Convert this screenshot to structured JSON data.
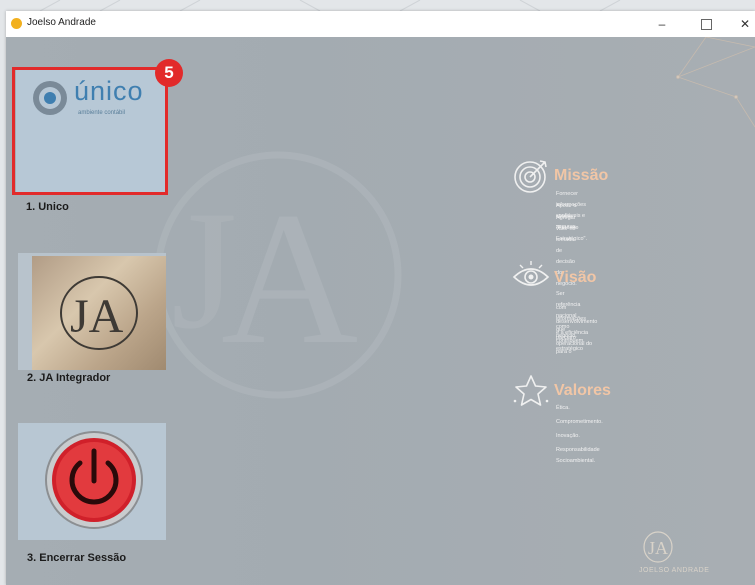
{
  "window": {
    "title": "Joelso Andrade",
    "min_label": "–",
    "close_label": "✕"
  },
  "tiles": [
    {
      "label": "1. Unico",
      "highlighted": true,
      "badge": "5"
    },
    {
      "label": "2. JA Integrador"
    },
    {
      "label": "3. Encerrar Sessão"
    }
  ],
  "unico": {
    "word": "único",
    "sub": "ambiente contábil"
  },
  "sections": {
    "missao": {
      "title": "Missão",
      "lines": [
        "Fornecer informações confiáveis e seguras.",
        "Apoiar o cliente \"Parceiro Estratégico\".",
        "Agregar valor no tomada de decisão do negócio."
      ]
    },
    "visao": {
      "title": "Visão",
      "lines": [
        "Ser referência nacional como parceiro estratégico",
        "com informações que contribuem para o",
        "desenvolvimento e a eficiência operacional do",
        "negócio."
      ]
    },
    "valores": {
      "title": "Valores",
      "lines": [
        "Ética.",
        "Comprometimento.",
        "Inovação.",
        "Responsabilidade Socioambiental."
      ]
    }
  },
  "brand": {
    "name": "JOELSO ANDRADE",
    "logo_text": "JA"
  },
  "colors": {
    "highlight": "#e22a2a",
    "section_title": "#f1c6a6",
    "power_red": "#d0202a"
  },
  "icons": {
    "missao": "target-icon",
    "visao": "eye-icon",
    "valores": "star-icon",
    "power": "power-icon"
  }
}
